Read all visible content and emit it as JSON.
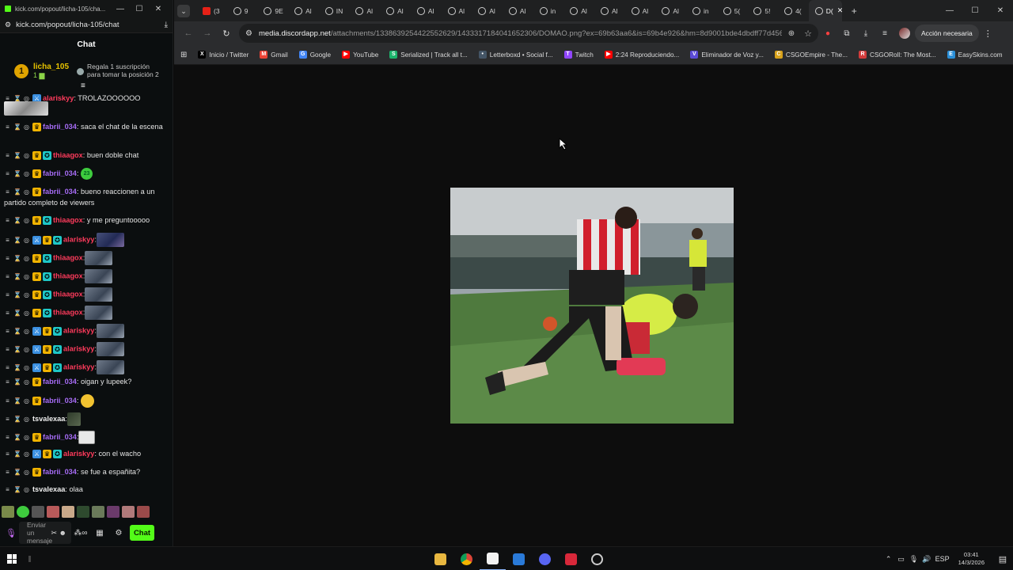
{
  "chat_window": {
    "title": "kick.com/popout/licha-105/cha...",
    "url": "kick.com/popout/licha-105/chat",
    "header": "Chat",
    "pinned": {
      "rank": "1",
      "username": "licha_105",
      "count": "1",
      "gift_text_1": "Regala 1 suscripción",
      "gift_text_2": "para tomar la posición 2"
    },
    "messages": [
      {
        "user": "alariskyy",
        "text": ": TROLAZOOOOOO",
        "top": "partial"
      },
      {
        "user": "fabrii_034",
        "text": ": saca el chat de la escena"
      },
      {
        "user": "thiaagox",
        "text": ": buen doble chat"
      },
      {
        "user": "fabrii_034",
        "text": ":"
      },
      {
        "user": "fabrii_034",
        "text": ": bueno reaccionen a un partido completo de viewers"
      },
      {
        "user": "thiaagox",
        "text": ": y me preguntooooo"
      },
      {
        "user": "alariskyy",
        "text": ":"
      },
      {
        "user": "thiaagox",
        "text": ":"
      },
      {
        "user": "thiaagox",
        "text": ":"
      },
      {
        "user": "thiaagox",
        "text": ":"
      },
      {
        "user": "thiaagox",
        "text": ":"
      },
      {
        "user": "alariskyy",
        "text": ":"
      },
      {
        "user": "alariskyy",
        "text": ":"
      },
      {
        "user": "alariskyy",
        "text": ":"
      },
      {
        "user": "fabrii_034",
        "text": ": oigan y lupeek?"
      },
      {
        "user": "fabrii_034",
        "text": ":"
      },
      {
        "user": "tsvalexaa",
        "text": ":"
      },
      {
        "user": "fabrii_034",
        "text": ":"
      },
      {
        "user": "alariskyy",
        "text": ": con el wacho"
      },
      {
        "user": "fabrii_034",
        "text": ": se fue a españita?"
      },
      {
        "user": "tsvalexaa",
        "text": ": olaa"
      }
    ],
    "composer": {
      "placeholder": "Enviar un mensaje",
      "chat_button": "Chat"
    }
  },
  "browser": {
    "tabs": [
      "(3",
      "9",
      "9E",
      "Al",
      "IN",
      "Al",
      "Al",
      "Al",
      "Al",
      "Al",
      "Al",
      "in",
      "Al",
      "Al",
      "Al",
      "Al",
      "in",
      "5(",
      "5!",
      "4(",
      "D("
    ],
    "address": {
      "host": "media.discordapp.net",
      "path": "/attachments/1338639254422552629/1433317184041652306/DOMAO.png?ex=69b63aa6&is=69b4e926&hm=8d9001bde4dbdff77d456d4..."
    },
    "action_button": "Acción necesaria",
    "bookmarks": [
      {
        "label": "Inicio / Twitter",
        "color": "#000000",
        "glyph": "X"
      },
      {
        "label": "Gmail",
        "color": "#ea4335",
        "glyph": "M"
      },
      {
        "label": "Google",
        "color": "#4285f4",
        "glyph": "G"
      },
      {
        "label": "YouTube",
        "color": "#ff0000",
        "glyph": "▶"
      },
      {
        "label": "Serialized | Track all t...",
        "color": "#1bb36b",
        "glyph": "S"
      },
      {
        "label": "Letterboxd • Social f...",
        "color": "#445566",
        "glyph": "•"
      },
      {
        "label": "Twitch",
        "color": "#9146ff",
        "glyph": "T"
      },
      {
        "label": "2:24 Reproduciendo...",
        "color": "#ff0000",
        "glyph": "▶"
      },
      {
        "label": "Eliminador de Voz y...",
        "color": "#5b4bd6",
        "glyph": "V"
      },
      {
        "label": "CSGOEmpire - The...",
        "color": "#d8a21b",
        "glyph": "C"
      },
      {
        "label": "CSGORoll: The Most...",
        "color": "#d23b3b",
        "glyph": "R"
      },
      {
        "label": "EasySkins.com",
        "color": "#2a8fd8",
        "glyph": "E"
      }
    ]
  },
  "taskbar": {
    "lang": "ESP",
    "time": "03:41",
    "date": "14/3/2026"
  },
  "colors": {
    "kick_green": "#53fc18",
    "purple_user": "#a66cf5",
    "red_user": "#ff3b5c"
  }
}
